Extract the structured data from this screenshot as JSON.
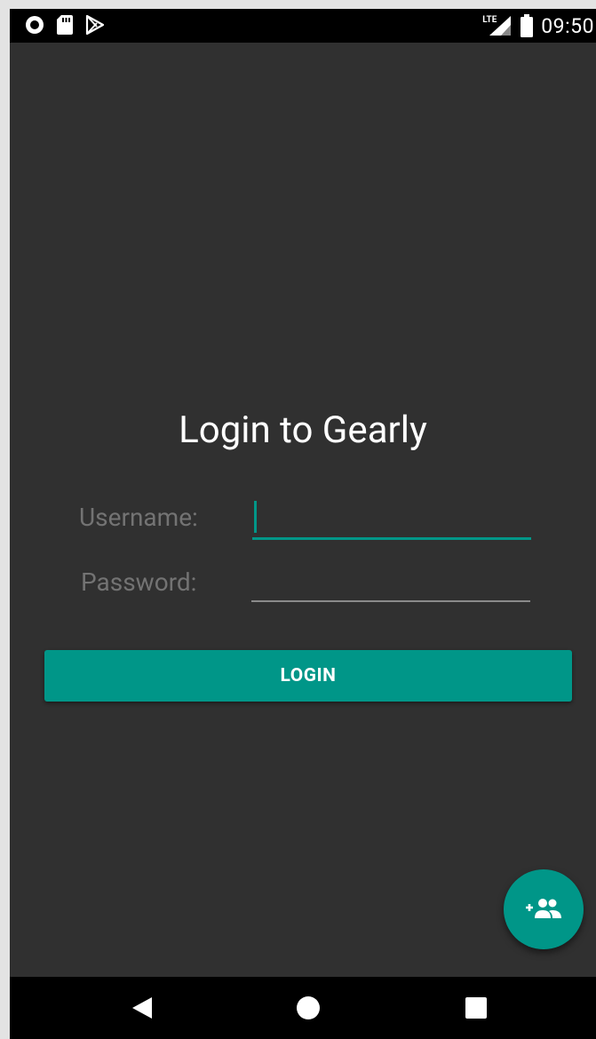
{
  "status_bar": {
    "time": "09:50",
    "network": "LTE",
    "icons": [
      "record-icon",
      "sd-card-icon",
      "play-store-icon",
      "signal-icon",
      "battery-icon"
    ]
  },
  "screen": {
    "title": "Login to Gearly",
    "username_label": "Username:",
    "password_label": "Password:",
    "username_value": "",
    "password_value": "",
    "login_button": "LOGIN",
    "fab_icon": "add-group-icon"
  },
  "nav_bar": {
    "icons": [
      "back-icon",
      "home-icon",
      "recents-icon"
    ]
  },
  "colors": {
    "accent": "#009688",
    "background": "#303030",
    "label": "#737373"
  }
}
